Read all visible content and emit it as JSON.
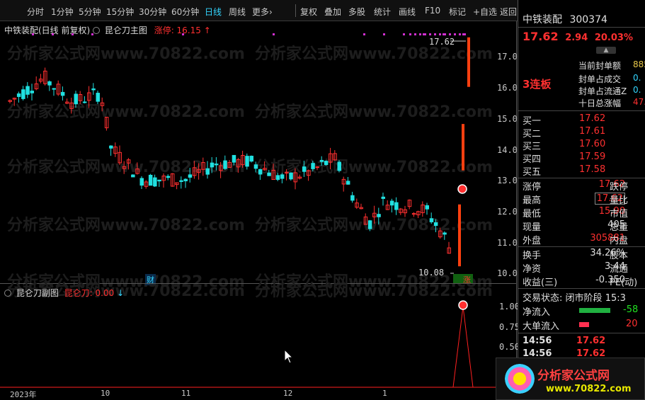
{
  "nav": {
    "tabs": [
      "分时",
      "1分钟",
      "5分钟",
      "15分钟",
      "30分钟",
      "60分钟",
      "日线",
      "周线",
      "更多"
    ],
    "more_arrow": "›",
    "tools": [
      "复权",
      "叠加",
      "多股",
      "统计",
      "画线",
      "F10",
      "标记",
      "+自选",
      "返回"
    ],
    "active_tab": "日线"
  },
  "main_panel": {
    "title_stock": "中铁装配(日线 前复权)",
    "title_indicator": "昆仑刀主图",
    "title_value": "涨停: 16.15",
    "title_value_arrow": "↑",
    "y_ticks": [
      "17.00",
      "16.00",
      "15.00",
      "14.00",
      "13.00",
      "12.00",
      "11.00",
      "10.00"
    ],
    "high_marker": "17.62",
    "low_marker": "10.08",
    "badge_cai": "财",
    "badge_zhang": "涨",
    "watermark": "分析家公式网www.70822.com"
  },
  "sub_panel": {
    "title": "昆仑刀副图",
    "value_label": "昆仑刀: 0.00",
    "value_arrow": "↓",
    "y_ticks": [
      "1.00",
      "0.75",
      "0.50"
    ],
    "x_labels": [
      "2023年",
      "10",
      "11",
      "12",
      "1"
    ]
  },
  "info": {
    "stock_name": "中铁装配",
    "stock_code": "300374",
    "price": "17.62",
    "change": "2.94",
    "change_pct": "20.03%",
    "limit_badge": "3连板",
    "seal_labels": [
      "当前封单额",
      "封单占成交",
      "封单占流通Z",
      "十日总涨幅"
    ],
    "seal_values": [
      "885",
      "0.",
      "0.",
      "47."
    ],
    "order_book": [
      {
        "label": "买一",
        "price": "17.62"
      },
      {
        "label": "买二",
        "price": "17.61"
      },
      {
        "label": "买三",
        "price": "17.60"
      },
      {
        "label": "买四",
        "price": "17.59"
      },
      {
        "label": "买五",
        "price": "17.58"
      }
    ],
    "stats": [
      {
        "label": "涨停",
        "value": "17.62",
        "label2": "跌停",
        "color": "red"
      },
      {
        "label": "最高",
        "value": "17.62",
        "label2": "量比",
        "color": "red"
      },
      {
        "label": "最低",
        "value": "15.90",
        "label2": "市值",
        "color": "red"
      },
      {
        "label": "现量",
        "value": "405",
        "label2": "总量",
        "color": "white"
      },
      {
        "label": "外盘",
        "value": "305881",
        "label2": "内盘",
        "color": "red"
      }
    ],
    "stats2": [
      {
        "label": "换手",
        "value": "34.26%",
        "label2": "股本",
        "color": "white"
      },
      {
        "label": "净资",
        "value": "3.44",
        "label2": "流通",
        "color": "white"
      },
      {
        "label": "收益(三)",
        "value": "-0.350",
        "label2": "PE(动)",
        "color": "white"
      }
    ],
    "trade_status_label": "交易状态:",
    "trade_status": "闭市阶段",
    "trade_status_time": "15:3",
    "net_inflow_label": "净流入",
    "net_inflow_value": "-58",
    "big_inflow_label": "大单流入",
    "big_inflow_value": "20",
    "ticks": [
      {
        "time": "14:56",
        "price": "17.62"
      },
      {
        "time": "14:56",
        "price": "17.62"
      }
    ]
  },
  "logo": {
    "name": "分析家公式网",
    "url": "www.70822.com"
  },
  "colors": {
    "up": "#ff3030",
    "down": "#20e0e0",
    "accent": "#33d6ff",
    "magenta": "#d030d0"
  }
}
